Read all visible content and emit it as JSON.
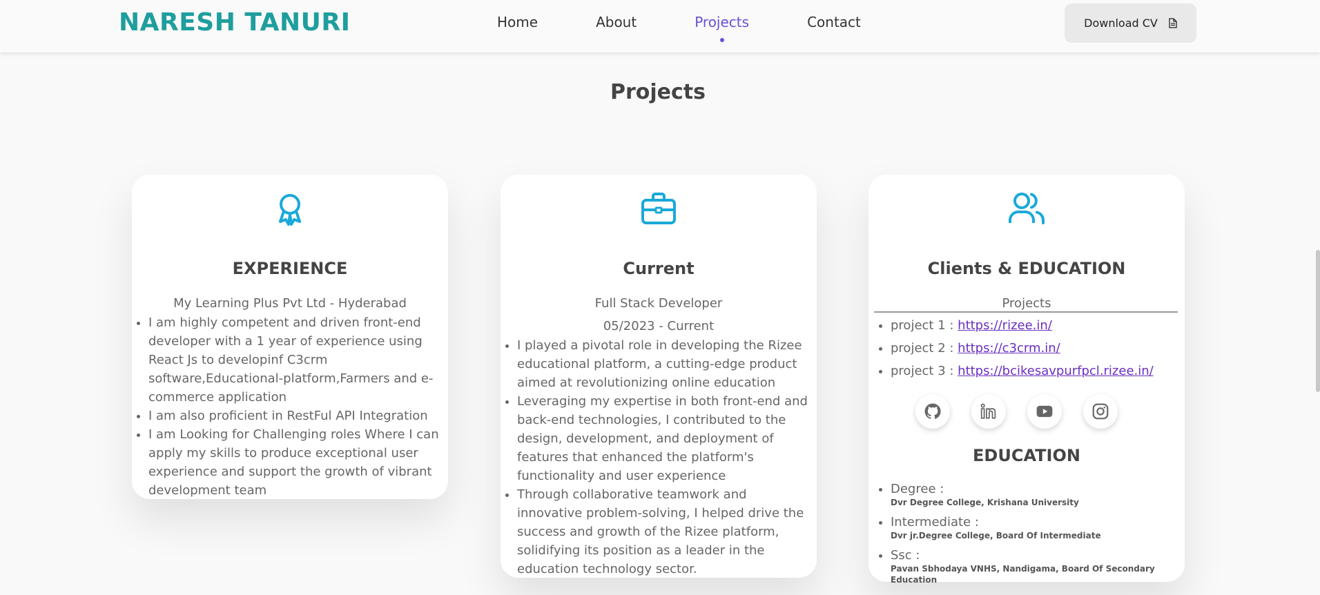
{
  "header": {
    "logo": "NARESH TANURI",
    "nav": [
      "Home",
      "About",
      "Projects",
      "Contact"
    ],
    "active_nav": "Projects",
    "download_cv": "Download CV"
  },
  "section_title": "Projects",
  "cards": {
    "experience": {
      "icon": "award-icon",
      "title": "EXPERIENCE",
      "company": "My Learning Plus Pvt Ltd - Hyderabad",
      "bullets": [
        "I am highly competent and driven front-end developer with a 1 year of experience using React Js to developinf C3crm software,Educational-platform,Farmers and e-commerce application",
        "I am also proficient in RestFul API Integration",
        "I am Looking for Challenging roles Where I can apply my skills to produce exceptional user experience and support the growth of vibrant development team"
      ]
    },
    "current": {
      "icon": "briefcase-icon",
      "title": "Current",
      "role": "Full Stack Developer",
      "period": "05/2023 - Current",
      "bullets": [
        "I played a pivotal role in developing the Rizee educational platform, a cutting-edge product aimed at revolutionizing online education",
        "Leveraging my expertise in both front-end and back-end technologies, I contributed to the design, development, and deployment of features that enhanced the platform's functionality and user experience",
        "Through collaborative teamwork and innovative problem-solving, I helped drive the success and growth of the Rizee platform, solidifying its position as a leader in the education technology sector."
      ]
    },
    "clients": {
      "icon": "users-icon",
      "title": "Clients & EDUCATION",
      "projects_label": "Projects",
      "projects": [
        {
          "label": "project 1 : ",
          "link": "https://rizee.in/"
        },
        {
          "label": "project 2 : ",
          "link": "https://c3crm.in/"
        },
        {
          "label": "project 3 : ",
          "link": "https://bcikesavpurfpcl.rizee.in/"
        }
      ],
      "socials": [
        "github-icon",
        "linkedin-icon",
        "youtube-icon",
        "instagram-icon"
      ],
      "education_title": "EDUCATION",
      "education": [
        {
          "label": "Degree :",
          "detail": "Dvr Degree College, Krishana University"
        },
        {
          "label": "Intermediate :",
          "detail": "Dvr jr.Degree College, Board Of Intermediate"
        },
        {
          "label": "Ssc :",
          "detail": "Pavan Sbhodaya VNHS, Nandigama, Board Of Secondary Education"
        }
      ]
    }
  },
  "colors": {
    "accent": "#6a4fd3",
    "logo": "#1f9e9e",
    "icon": "#1aa9d8",
    "link": "#6a2fc0"
  }
}
